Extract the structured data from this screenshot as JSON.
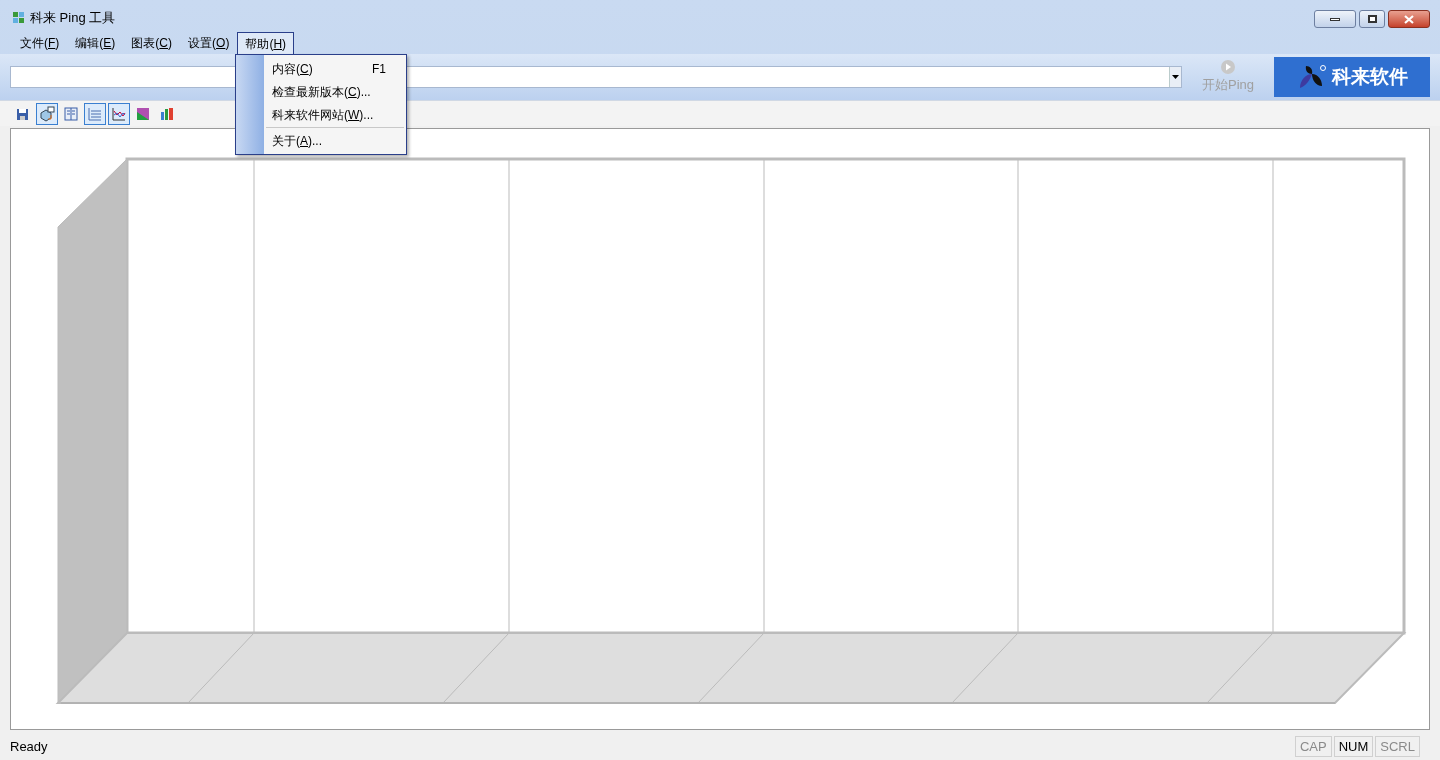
{
  "window": {
    "title": "科来 Ping 工具"
  },
  "menu_bar": [
    {
      "prefix": "文件(",
      "key": "F",
      "suffix": ")",
      "selected": false
    },
    {
      "prefix": "编辑(",
      "key": "E",
      "suffix": ")",
      "selected": false
    },
    {
      "prefix": "图表(",
      "key": "C",
      "suffix": ")",
      "selected": false
    },
    {
      "prefix": "设置(",
      "key": "O",
      "suffix": ")",
      "selected": false
    },
    {
      "prefix": "帮助(",
      "key": "H",
      "suffix": ")",
      "selected": true
    }
  ],
  "open_menu": {
    "items": [
      {
        "prefix": "内容(",
        "key": "C",
        "suffix": ")",
        "shortcut": "F1"
      },
      {
        "prefix": "检查最新版本(",
        "key": "C",
        "suffix": ")..."
      },
      {
        "prefix": "科来软件网站(",
        "key": "W",
        "suffix": ")...",
        "separator_after": true
      },
      {
        "prefix": "关于(",
        "key": "A",
        "suffix": ")..."
      }
    ]
  },
  "address_bar": {
    "ping_button": {
      "label": "开始Ping",
      "disabled": true
    },
    "logo": "科来软件"
  },
  "toolbar": [
    {
      "kind": "save",
      "pressed": false
    },
    {
      "kind": "export",
      "pressed": true
    },
    {
      "kind": "book",
      "pressed": false
    },
    {
      "kind": "grid",
      "pressed": true
    },
    {
      "kind": "line",
      "pressed": true
    },
    {
      "kind": "area",
      "pressed": false
    },
    {
      "kind": "bar",
      "pressed": false
    }
  ],
  "status_bar": {
    "text": "Ready",
    "indicators": [
      {
        "label": "CAP",
        "on": false
      },
      {
        "label": "NUM",
        "on": true
      },
      {
        "label": "SCRL",
        "on": false
      }
    ]
  }
}
